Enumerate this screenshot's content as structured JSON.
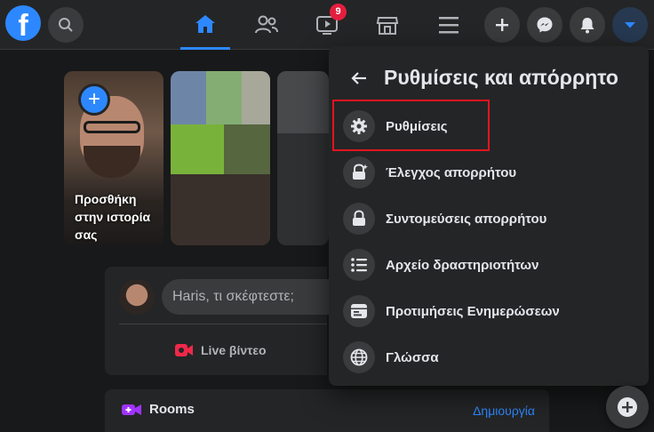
{
  "topbar": {
    "logo_letter": "f",
    "video_badge": "9",
    "icons": [
      "search-icon",
      "home-icon",
      "friends-icon",
      "watch-icon",
      "marketplace-icon",
      "menu-icon",
      "plus-icon",
      "messenger-icon",
      "notifications-icon",
      "account-chevron-icon"
    ]
  },
  "stories": {
    "create_label": "Προσθήκη στην ιστορία σας"
  },
  "composer": {
    "placeholder": "Haris, τι σκέφτεστε;",
    "live_label": "Live βίντεο"
  },
  "rooms": {
    "title": "Rooms",
    "create": "Δημιουργία"
  },
  "settings_menu": {
    "title": "Ρυθμίσεις και απόρρητο",
    "items": [
      {
        "label": "Ρυθμίσεις",
        "icon": "gear-icon"
      },
      {
        "label": "Έλεγχος απορρήτου",
        "icon": "privacy-check-icon"
      },
      {
        "label": "Συντομεύσεις απορρήτου",
        "icon": "lock-icon"
      },
      {
        "label": "Αρχείο δραστηριοτήτων",
        "icon": "activity-log-icon"
      },
      {
        "label": "Προτιμήσεις Ενημερώσεων",
        "icon": "news-feed-preferences-icon"
      },
      {
        "label": "Γλώσσα",
        "icon": "globe-icon"
      }
    ]
  },
  "colors": {
    "accent": "#2d88ff",
    "badge": "#e41e3f",
    "highlight": "#e3141e",
    "background": "#18191a",
    "surface": "#242526"
  }
}
